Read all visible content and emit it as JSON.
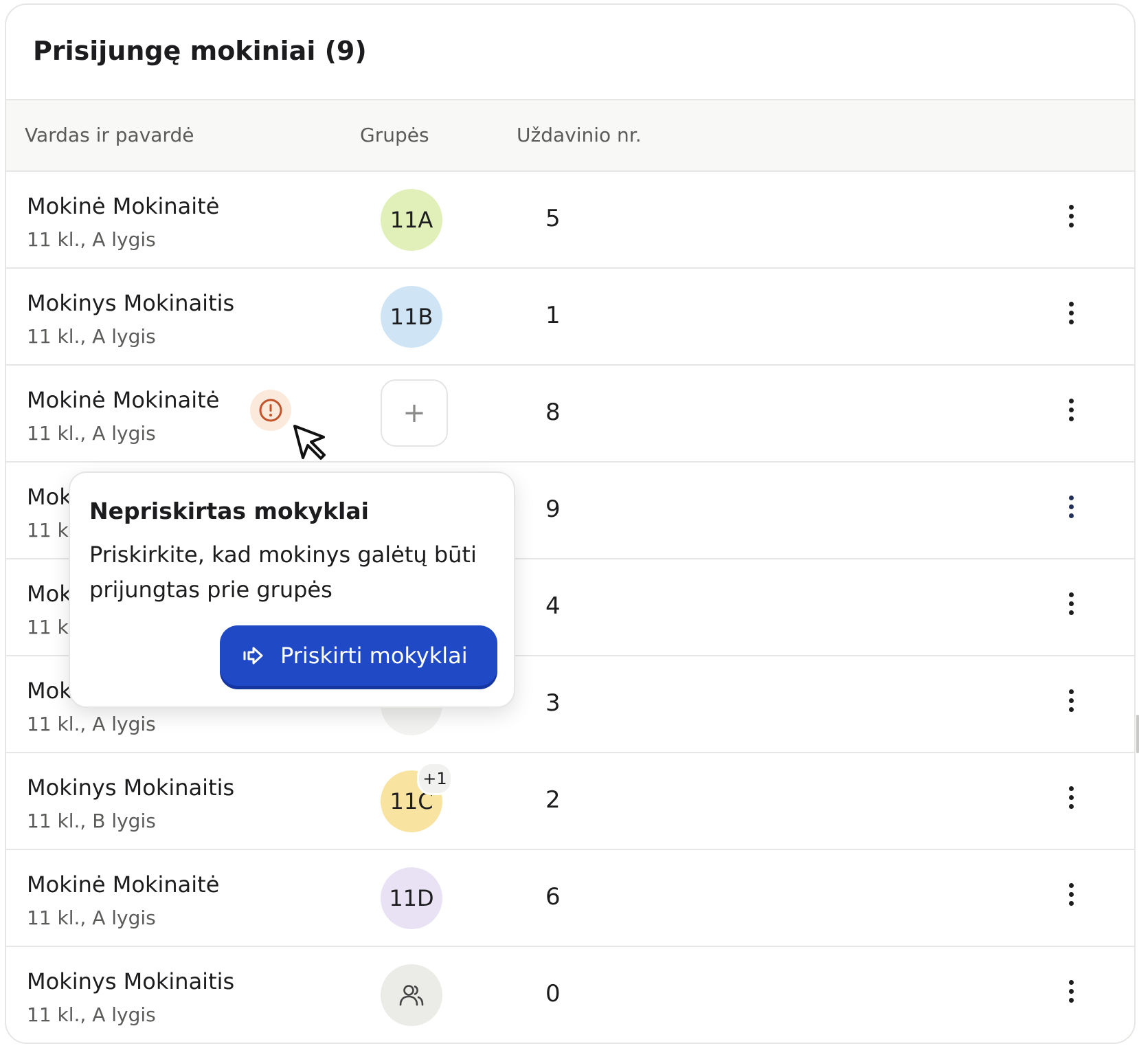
{
  "panel": {
    "title": "Prisijungę mokiniai (9)"
  },
  "columns": {
    "name": "Vardas ir pavardė",
    "groups": "Grupės",
    "task": "Uždavinio nr."
  },
  "rows": [
    {
      "name": "Mokinė Mokinaitė",
      "sub": "11 kl., A lygis",
      "group": "11A",
      "group_color": "#e0f0b8",
      "task": "5"
    },
    {
      "name": "Mokinys Mokinaitis",
      "sub": "11 kl., A lygis",
      "group": "11B",
      "group_color": "#cfe5f6",
      "task": "1"
    },
    {
      "name": "Mokinė Mokinaitė",
      "sub": "11 kl., A lygis",
      "group": "+",
      "task": "8",
      "warning_icon": "alert-circle-icon"
    },
    {
      "name": "Mok",
      "sub": "11 kl.,",
      "task": "9"
    },
    {
      "name": "Mok",
      "sub": "11 kl.,",
      "task": "4"
    },
    {
      "name": "Mok",
      "sub": "11 kl., A lygis",
      "task": "3"
    },
    {
      "name": "Mokinys Mokinaitis",
      "sub": "11 kl., B lygis",
      "group": "11C",
      "group_color": "#f8e3a0",
      "group_extra": "+1",
      "task": "2"
    },
    {
      "name": "Mokinė Mokinaitė",
      "sub": "11 kl., A lygis",
      "group": "11D",
      "group_color": "#e8e2f4",
      "task": "6"
    },
    {
      "name": "Mokinys Mokinaitis",
      "sub": "11 kl., A lygis",
      "group_icon": "users-icon",
      "group_color": "#ebebe8",
      "task": "0"
    }
  ],
  "popover": {
    "title": "Nepriskirtas mokyklai",
    "text": "Priskirkite, kad mokinys galėtų būti prijungtas prie grupės",
    "button": "Priskirti mokyklai",
    "button_icon": "arrow-right-icon",
    "button_color": "#2049c6"
  }
}
